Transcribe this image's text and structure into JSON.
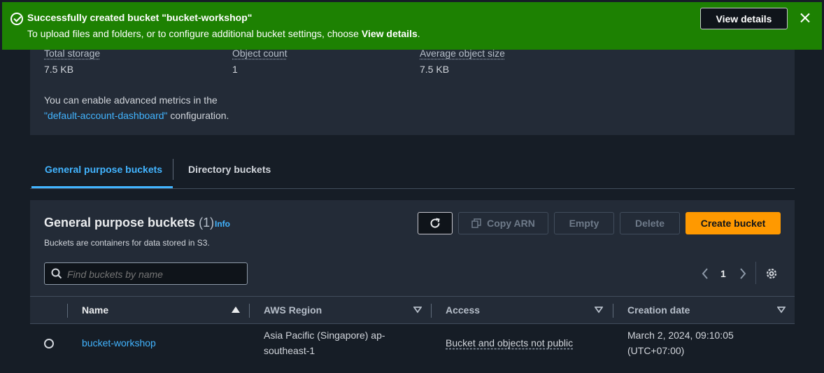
{
  "banner": {
    "title": "Successfully created bucket \"bucket-workshop\"",
    "desc_prefix": "To upload files and folders, or to configure additional bucket settings, choose ",
    "desc_bold": "View details",
    "desc_suffix": ".",
    "view_details_label": "View details",
    "color": "#1d8102"
  },
  "metrics": {
    "total_storage_label": "Total storage",
    "total_storage_value": "7.5 KB",
    "object_count_label": "Object count",
    "object_count_value": "1",
    "avg_size_label": "Average object size",
    "avg_size_value": "7.5 KB",
    "advanced_prefix": "You can enable advanced metrics in the",
    "advanced_link": "\"default-account-dashboard\"",
    "advanced_suffix": " configuration."
  },
  "tabs": [
    {
      "label": "General purpose buckets",
      "active": true
    },
    {
      "label": "Directory buckets",
      "active": false
    }
  ],
  "panel": {
    "title": "General purpose buckets",
    "count": "(1)",
    "info": "Info",
    "desc": "Buckets are containers for data stored in S3.",
    "buttons": {
      "copy_arn": "Copy ARN",
      "empty": "Empty",
      "delete": "Delete",
      "create": "Create bucket"
    },
    "search_placeholder": "Find buckets by name",
    "page": "1"
  },
  "table": {
    "headers": [
      "Name",
      "AWS Region",
      "Access",
      "Creation date"
    ],
    "rows": [
      {
        "name": "bucket-workshop",
        "region_line1": "Asia Pacific (Singapore) ap-",
        "region_line2": "southeast-1",
        "access": "Bucket and objects not public",
        "date_line1": "March 2, 2024, 09:10:05",
        "date_line2": "(UTC+07:00)"
      }
    ]
  },
  "colors": {
    "accent": "#42b4ff",
    "primary_button": "#ff9900",
    "background": "#161d26",
    "panel": "#232b37"
  }
}
